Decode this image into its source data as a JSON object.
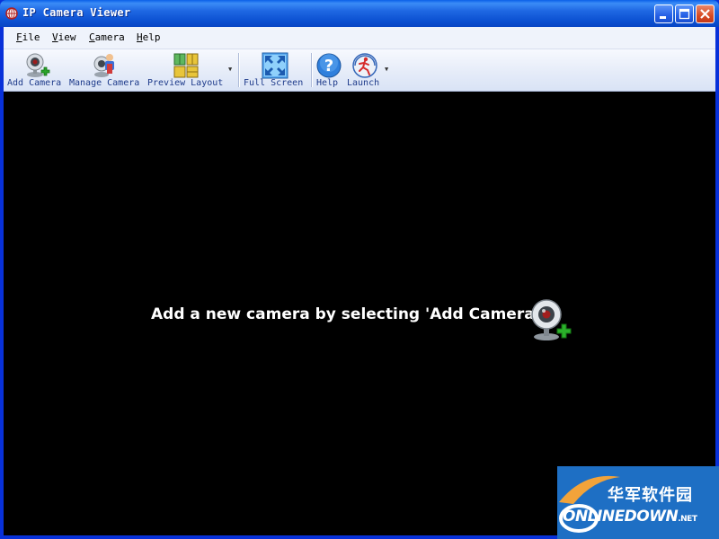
{
  "window": {
    "title": "IP Camera Viewer",
    "controls": [
      "minimize",
      "maximize",
      "close"
    ]
  },
  "menu": [
    {
      "label": "File",
      "u": "F",
      "rest": "ile"
    },
    {
      "label": "View",
      "u": "V",
      "rest": "iew"
    },
    {
      "label": "Camera",
      "u": "C",
      "rest": "amera"
    },
    {
      "label": "Help",
      "u": "H",
      "rest": "elp"
    }
  ],
  "toolbar": {
    "add_camera": "Add Camera",
    "manage_camera": "Manage Camera",
    "preview_layout": "Preview Layout",
    "full_screen": "Full Screen",
    "help": "Help",
    "launch": "Launch"
  },
  "content": {
    "message": "Add a new camera by selecting 'Add Camera'"
  },
  "watermark": {
    "cn": "华军软件园",
    "en": "ONLINEDOWN",
    "suffix": ".NET"
  },
  "colors": {
    "titlebar": "#0a4fd0",
    "menubar": "#eff3fb",
    "content_bg": "#000000",
    "watermark_bg": "#1e6fc4"
  }
}
